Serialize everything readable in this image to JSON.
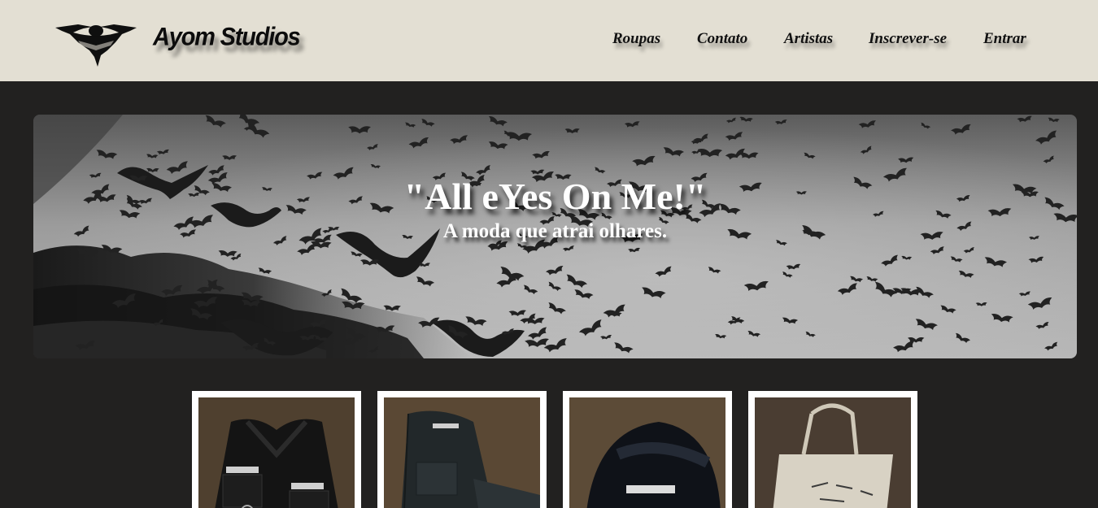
{
  "header": {
    "brand": "Ayom Studios",
    "logo_icon": "bat-eye-logo-icon",
    "background": "#e3dfd3",
    "nav": [
      {
        "label": "Roupas"
      },
      {
        "label": "Contato"
      },
      {
        "label": "Artistas"
      },
      {
        "label": "Inscrever-se"
      },
      {
        "label": "Entrar"
      }
    ]
  },
  "hero": {
    "title": "\"All eYes On Me!\"",
    "subtitle": "A moda que atrai olhares.",
    "image": "bats-flock-grayscale-image"
  },
  "products": [
    {
      "image": "black-utility-vest-image"
    },
    {
      "image": "dark-cargo-pants-image"
    },
    {
      "image": "black-mesh-cap-image"
    },
    {
      "image": "canvas-tote-bag-image"
    }
  ],
  "colors": {
    "page_background": "#222120",
    "header_background": "#e3dfd3",
    "card_border": "#ffffff",
    "text_dark": "#111111",
    "text_light": "#ffffff"
  }
}
